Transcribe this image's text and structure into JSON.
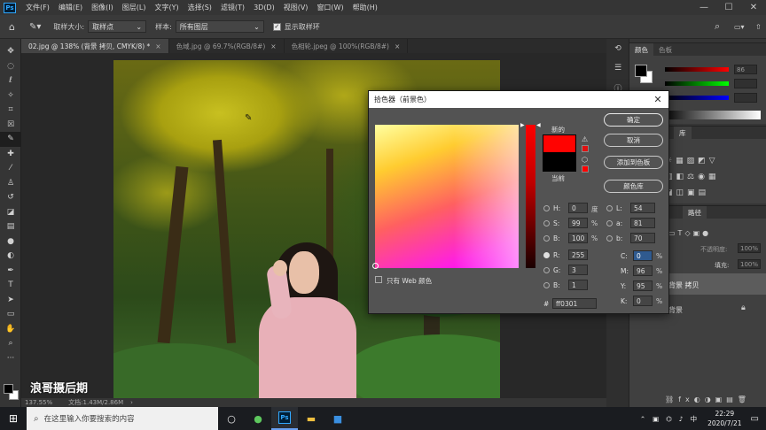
{
  "menubar": {
    "logo": "Ps",
    "items": [
      "文件(F)",
      "编辑(E)",
      "图像(I)",
      "图层(L)",
      "文字(Y)",
      "选择(S)",
      "滤镜(T)",
      "3D(D)",
      "视图(V)",
      "窗口(W)",
      "帮助(H)"
    ],
    "window_controls": [
      "—",
      "☐",
      "✕"
    ]
  },
  "options": {
    "sample_size_label": "取样大小:",
    "sample_size_value": "取样点",
    "sample_label": "样本:",
    "sample_value": "所有图层",
    "show_ring_label": "显示取样环"
  },
  "tabs": [
    {
      "label": "02.jpg @ 138% (背景 拷贝, CMYK/8) *",
      "close": "×"
    },
    {
      "label": "色域.jpg @ 69.7%(RGB/8#)",
      "close": "×"
    },
    {
      "label": "色相轮.jpeg @ 100%(RGB/8#)",
      "close": "×"
    }
  ],
  "canvas": {
    "watermark": "浪哥摄后期"
  },
  "status": {
    "zoom": "137.55%",
    "doc": "文档:1.43M/2.86M",
    "arrow": "›"
  },
  "panels": {
    "color_tabs": [
      "颜色",
      "色板"
    ],
    "adjust_label": "库",
    "layers_tab": "路径",
    "opacity_label": "不透明度:",
    "opacity_value": "100%",
    "fill_label": "填充:",
    "fill_value": "100%",
    "layer_copy": "背景 拷贝",
    "layer_bg": "背景",
    "slider_values": [
      "86",
      "",
      ""
    ]
  },
  "picker": {
    "title": "拾色器（前景色）",
    "close": "✕",
    "new_label": "新的",
    "current_label": "当前",
    "web_only_label": "只有 Web 颜色",
    "buttons": {
      "ok": "确定",
      "cancel": "取消",
      "add_swatch": "添加到色板",
      "libraries": "颜色库"
    },
    "hsb": [
      {
        "label": "H:",
        "value": "0",
        "unit": "度"
      },
      {
        "label": "S:",
        "value": "99",
        "unit": "%"
      },
      {
        "label": "B:",
        "value": "100",
        "unit": "%"
      }
    ],
    "rgb": [
      {
        "label": "R:",
        "value": "255"
      },
      {
        "label": "G:",
        "value": "3"
      },
      {
        "label": "B:",
        "value": "1"
      }
    ],
    "lab": [
      {
        "label": "L:",
        "value": "54"
      },
      {
        "label": "a:",
        "value": "81"
      },
      {
        "label": "b:",
        "value": "70"
      }
    ],
    "cmyk": [
      {
        "label": "C:",
        "value": "0",
        "unit": "%"
      },
      {
        "label": "M:",
        "value": "96",
        "unit": "%"
      },
      {
        "label": "Y:",
        "value": "95",
        "unit": "%"
      },
      {
        "label": "K:",
        "value": "0",
        "unit": "%"
      }
    ],
    "hex_label": "#",
    "hex_value": "ff0301",
    "new_color": "#ff0301",
    "current_color": "#000000"
  },
  "taskbar": {
    "search_placeholder": "在这里输入你要搜索的内容",
    "time": "22:29",
    "date": "2020/7/21",
    "ime": "中",
    "ps_icon": "Ps"
  }
}
